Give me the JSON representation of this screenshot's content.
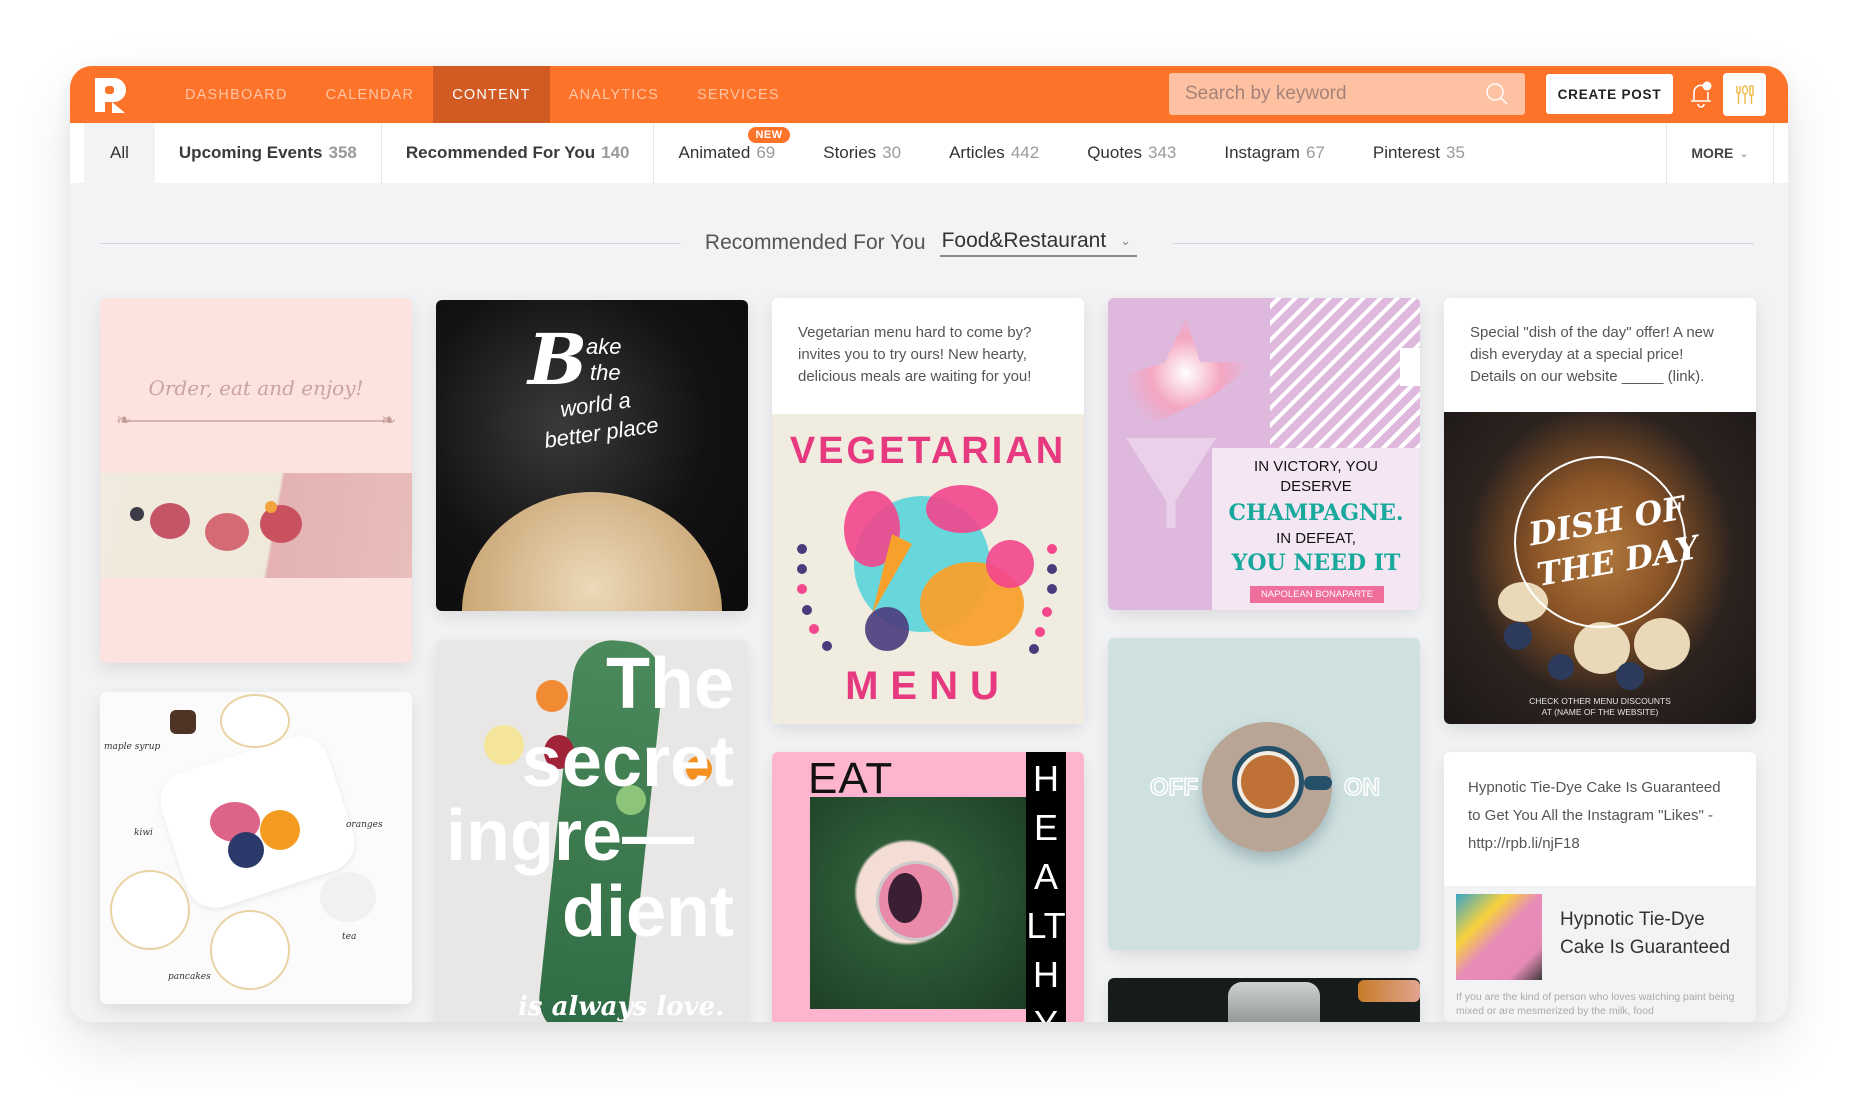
{
  "nav": {
    "items": [
      {
        "label": "DASHBOARD",
        "active": false
      },
      {
        "label": "CALENDAR",
        "active": false
      },
      {
        "label": "CONTENT",
        "active": true
      },
      {
        "label": "ANALYTICS",
        "active": false
      },
      {
        "label": "SERVICES",
        "active": false
      }
    ],
    "search_placeholder": "Search by keyword",
    "create_post_label": "CREATE POST",
    "brand_color": "#fd7329",
    "active_color": "#d15b22"
  },
  "tabs": {
    "items": [
      {
        "label": "All",
        "count": ""
      },
      {
        "label": "Upcoming Events",
        "count": "358"
      },
      {
        "label": "Recommended For You",
        "count": "140"
      },
      {
        "label": "Animated",
        "count": "69",
        "badge": "NEW"
      },
      {
        "label": "Stories",
        "count": "30"
      },
      {
        "label": "Articles",
        "count": "442"
      },
      {
        "label": "Quotes",
        "count": "343"
      },
      {
        "label": "Instagram",
        "count": "67"
      },
      {
        "label": "Pinterest",
        "count": "35"
      }
    ],
    "more_label": "MORE"
  },
  "section": {
    "title": "Recommended For You",
    "category_selected": "Food&Restaurant"
  },
  "cards": {
    "order": {
      "text": "Order, eat and enjoy!"
    },
    "bake": {
      "big_letter": "B",
      "line1": "ake",
      "line2": "the",
      "line3": "world a",
      "line4": "better place"
    },
    "vegetarian": {
      "caption": "Vegetarian menu hard to come by? invites you to try ours! New hearty, delicious meals are waiting for you!",
      "top_word": "VEGETARIAN",
      "bottom_word": "MENU"
    },
    "champagne": {
      "line1": "IN VICTORY, YOU",
      "line2": "DESERVE",
      "line3": "CHAMPAGNE.",
      "line4": "IN DEFEAT,",
      "line5": "YOU NEED IT",
      "author": "NAPOLEAN BONAPARTE"
    },
    "dish": {
      "caption": "Special \"dish of the day\" offer! A new dish everyday at a special price! Details on our website _____ (link).",
      "line1": "DISH OF",
      "line2": "THE DAY",
      "footer1": "CHECK OTHER MENU DISCOUNTS",
      "footer2": "AT (NAME OF THE WEBSITE)"
    },
    "breakfast": {
      "labels": [
        "maple syrup",
        "kiwi",
        "oranges",
        "tea",
        "pancakes"
      ]
    },
    "secret": {
      "l1": "The",
      "l2": "secret",
      "l3": "ingre—",
      "l4": "dient",
      "l5": "is always love."
    },
    "eat": {
      "word1": "EAT",
      "word2": "HEALTHY"
    },
    "coffee": {
      "off": "OFF",
      "on": "ON"
    },
    "article": {
      "caption": "Hypnotic Tie-Dye Cake Is Guaranteed to Get You All the Instagram \"Likes\" - http://rpb.li/njF18",
      "title": "Hypnotic Tie-Dye Cake Is Guaranteed",
      "excerpt": "If you are the kind of person who loves watching paint being mixed or are mesmerized by the milk, food"
    }
  }
}
